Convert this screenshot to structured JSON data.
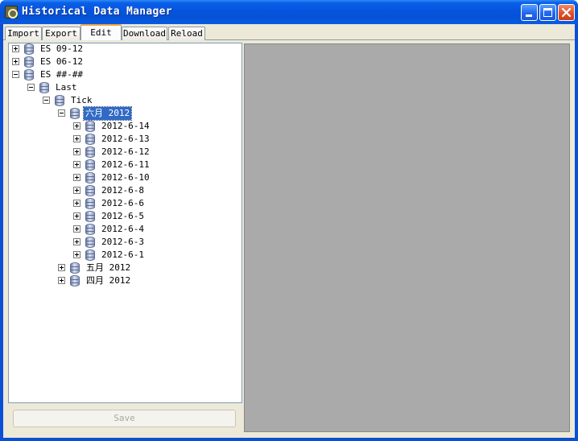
{
  "window": {
    "title": "Historical Data Manager"
  },
  "tabs": [
    "Import",
    "Export",
    "Edit",
    "Download",
    "Reload"
  ],
  "active_tab": "Edit",
  "tree": {
    "nodes": [
      {
        "label": "ES 09-12",
        "level": 0,
        "expander": "plus"
      },
      {
        "label": "ES 06-12",
        "level": 0,
        "expander": "plus"
      },
      {
        "label": "ES ##-##",
        "level": 0,
        "expander": "minus"
      },
      {
        "label": "Last",
        "level": 1,
        "expander": "minus"
      },
      {
        "label": "Tick",
        "level": 2,
        "expander": "minus"
      },
      {
        "label": "六月 2012",
        "level": 3,
        "expander": "minus",
        "selected": true
      },
      {
        "label": "2012-6-14",
        "level": 4,
        "expander": "plus"
      },
      {
        "label": "2012-6-13",
        "level": 4,
        "expander": "plus"
      },
      {
        "label": "2012-6-12",
        "level": 4,
        "expander": "plus"
      },
      {
        "label": "2012-6-11",
        "level": 4,
        "expander": "plus"
      },
      {
        "label": "2012-6-10",
        "level": 4,
        "expander": "plus"
      },
      {
        "label": "2012-6-8",
        "level": 4,
        "expander": "plus"
      },
      {
        "label": "2012-6-6",
        "level": 4,
        "expander": "plus"
      },
      {
        "label": "2012-6-5",
        "level": 4,
        "expander": "plus"
      },
      {
        "label": "2012-6-4",
        "level": 4,
        "expander": "plus"
      },
      {
        "label": "2012-6-3",
        "level": 4,
        "expander": "plus"
      },
      {
        "label": "2012-6-1",
        "level": 4,
        "expander": "plus"
      },
      {
        "label": "五月 2012",
        "level": 3,
        "expander": "plus"
      },
      {
        "label": "四月 2012",
        "level": 3,
        "expander": "plus"
      }
    ]
  },
  "save_button": {
    "label": "Save",
    "enabled": false
  },
  "colors": {
    "selection": "#316ac5",
    "titlebar": "#0552d6",
    "panel": "#aaaaaa"
  }
}
